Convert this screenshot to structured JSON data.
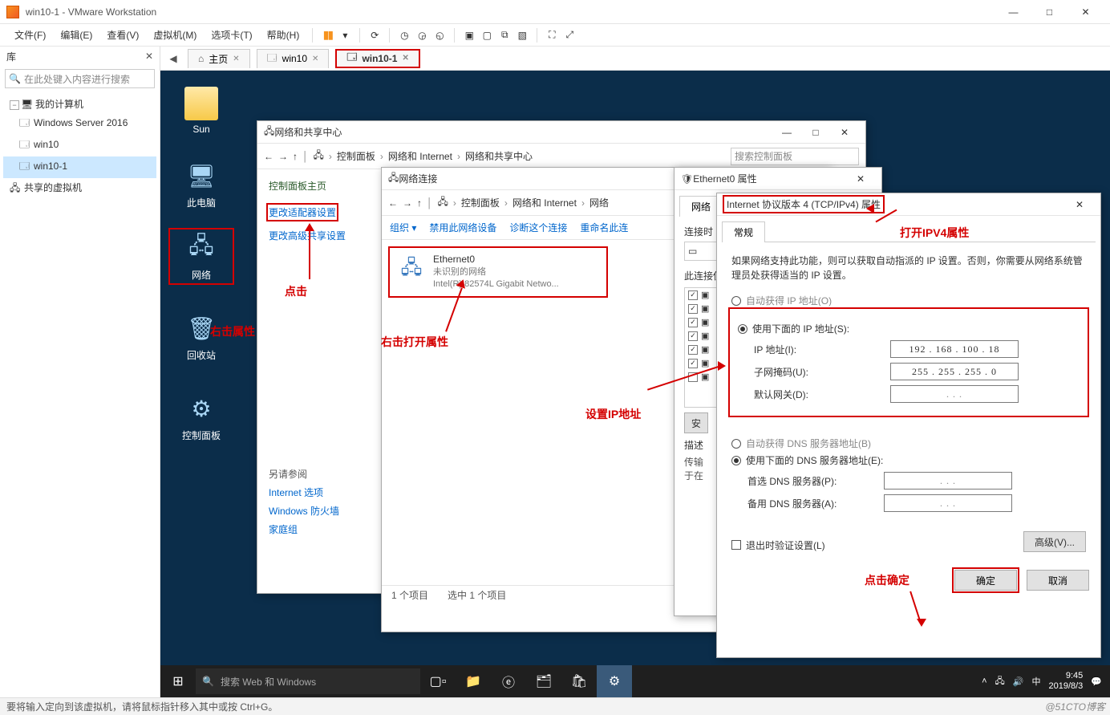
{
  "vmware": {
    "title": "win10-1 - VMware Workstation",
    "menus": [
      "文件(F)",
      "编辑(E)",
      "查看(V)",
      "虚拟机(M)",
      "选项卡(T)",
      "帮助(H)"
    ]
  },
  "library": {
    "header": "库",
    "search_placeholder": "在此处键入内容进行搜索",
    "root": "我的计算机",
    "items": [
      "Windows Server 2016",
      "win10",
      "win10-1"
    ],
    "shared": "共享的虚拟机"
  },
  "tabs": {
    "home": "主页",
    "t1": "win10",
    "t2": "win10-1"
  },
  "desktop": {
    "icons": [
      "Sun",
      "此电脑",
      "网络",
      "回收站",
      "控制面板"
    ]
  },
  "network_sharing": {
    "title": "网络和共享中心",
    "path": [
      "控制面板",
      "网络和 Internet",
      "网络和共享中心"
    ],
    "search": "搜索控制面板",
    "left_head": "控制面板主页",
    "link1": "更改适配器设置",
    "link2": "更改高级共享设置",
    "others_hd": "另请参阅",
    "others": [
      "Internet 选项",
      "Windows 防火墙",
      "家庭组"
    ]
  },
  "network_connections": {
    "title": "网络连接",
    "path": [
      "控制面板",
      "网络和 Internet",
      "网络"
    ],
    "toolbar": [
      "组织 ▾",
      "禁用此网络设备",
      "诊断这个连接",
      "重命名此连"
    ],
    "adapter": {
      "name": "Ethernet0",
      "line2": "未识别的网络",
      "line3": "Intel(R) 82574L Gigabit Netwo..."
    },
    "status1": "1 个项目",
    "status2": "选中 1 个项目"
  },
  "eth_props": {
    "title": "Ethernet0 属性",
    "tab": "网络",
    "connect_lbl": "连接时",
    "list_lbl": "此连接使",
    "desc_hd": "描述",
    "desc1": "传输",
    "desc2": "于在"
  },
  "ipv4": {
    "title": "Internet 协议版本 4 (TCP/IPv4) 属性",
    "tab": "常规",
    "info": "如果网络支持此功能，则可以获取自动指派的 IP 设置。否则，你需要从网络系统管理员处获得适当的 IP 设置。",
    "auto_ip": "自动获得 IP 地址(O)",
    "manual_ip": "使用下面的 IP 地址(S):",
    "ip_lbl": "IP 地址(I):",
    "ip_val": "192 . 168 . 100 . 18",
    "mask_lbl": "子网掩码(U):",
    "mask_val": "255 . 255 . 255 .  0",
    "gw_lbl": "默认网关(D):",
    "gw_val": ".     .     .",
    "auto_dns": "自动获得 DNS 服务器地址(B)",
    "manual_dns": "使用下面的 DNS 服务器地址(E):",
    "dns1_lbl": "首选 DNS 服务器(P):",
    "dns2_lbl": "备用 DNS 服务器(A):",
    "validate": "退出时验证设置(L)",
    "adv": "高级(V)...",
    "ok": "确定",
    "cancel": "取消"
  },
  "annotations": {
    "a1": "右击属性",
    "a2": "点击",
    "a3": "右击打开属性",
    "a4": "设置IP地址",
    "a5": "打开IPV4属性",
    "a6": "点击确定"
  },
  "taskbar": {
    "search": "搜索 Web 和 Windows",
    "time": "9:45",
    "date": "2019/8/3"
  },
  "statusbar": "要将输入定向到该虚拟机，请将鼠标指针移入其中或按 Ctrl+G。",
  "watermark": "@51CTO博客"
}
